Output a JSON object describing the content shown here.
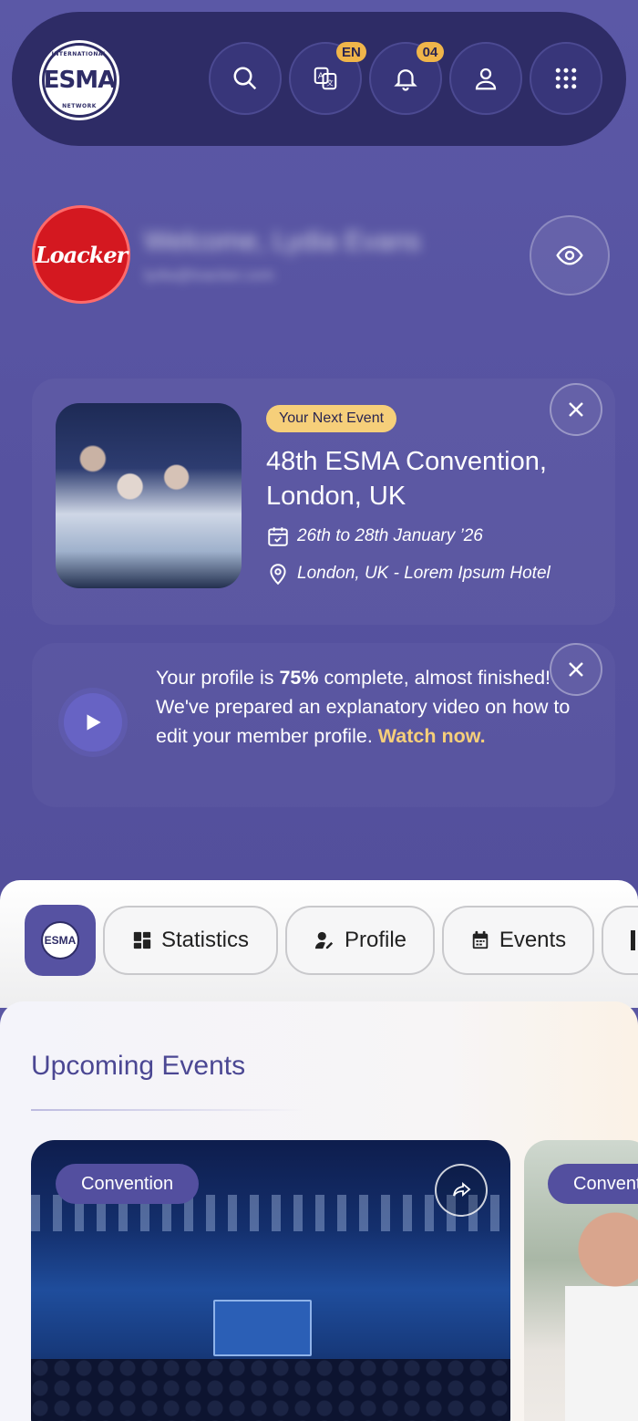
{
  "header": {
    "logo_text": "ESMA",
    "logo_ring_top": "INTERNATIONAL",
    "logo_ring_bottom": "NETWORK",
    "language_badge": "EN",
    "notifications_badge": "04",
    "icons": [
      "search-icon",
      "translate-icon",
      "bell-icon",
      "user-icon",
      "grid-menu-icon"
    ]
  },
  "welcome": {
    "avatar_text": "Loacker",
    "greeting": "Welcome, Lydia Evans",
    "subtitle": "lydia@loacker.com"
  },
  "next_event": {
    "badge": "Your Next Event",
    "title": "48th ESMA Convention, London, UK",
    "dates": "26th to 28th January ’26",
    "location": "London, UK - Lorem Ipsum Hotel"
  },
  "profile_prompt": {
    "text_before": "Your profile is ",
    "percent": "75%",
    "text_after": " complete, almost finished! We've prepared an explanatory video on how to edit your member profile. ",
    "link": "Watch now."
  },
  "tabs": [
    {
      "label": "Statistics",
      "icon": "dashboard-icon"
    },
    {
      "label": "Profile",
      "icon": "user-edit-icon"
    },
    {
      "label": "Events",
      "icon": "calendar-icon"
    }
  ],
  "upcoming": {
    "title": "Upcoming Events",
    "cards": [
      {
        "category": "Convention"
      },
      {
        "category": "Convention"
      }
    ]
  },
  "colors": {
    "brand_purple": "#5652a2",
    "navy": "#2e2c66",
    "accent_yellow": "#f6cf7a",
    "badge_orange": "#f0b54a",
    "loacker_red": "#d41820"
  }
}
